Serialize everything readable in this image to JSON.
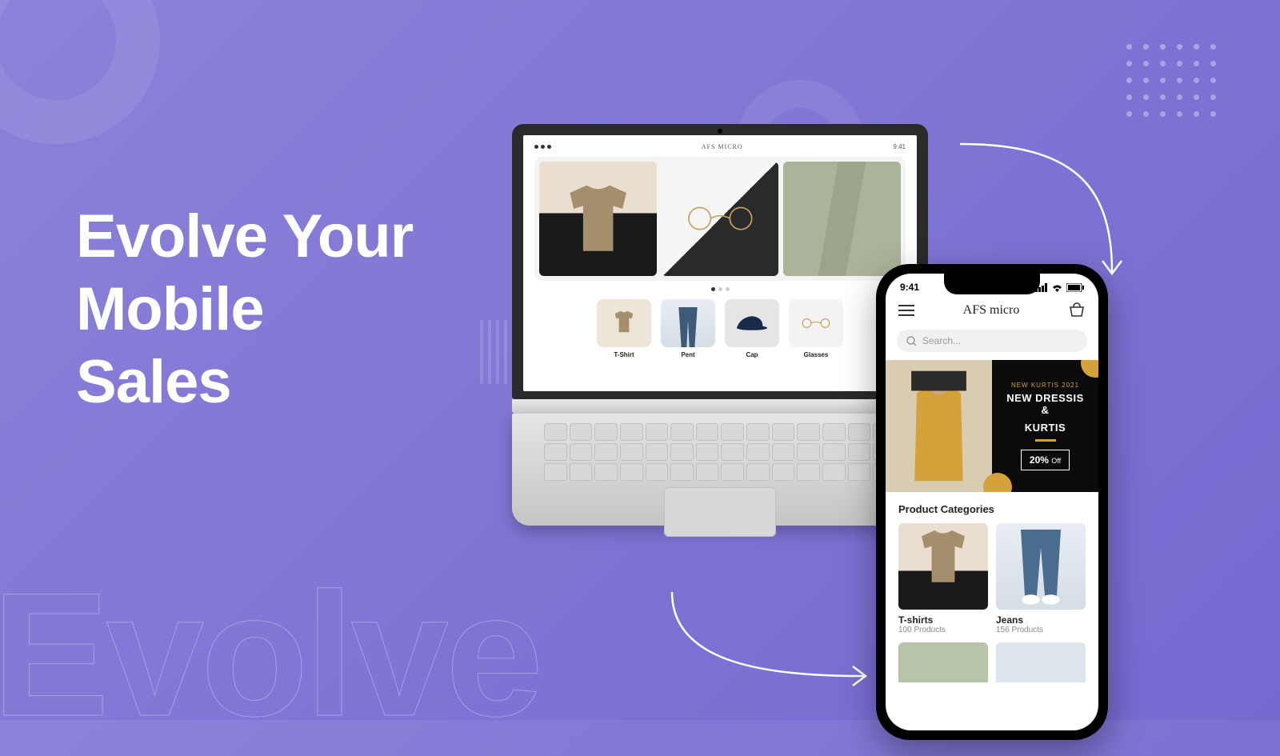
{
  "headline": {
    "line1": "Evolve Your",
    "line2": "Mobile",
    "line3": "Sales"
  },
  "decor": {
    "outline_word": "Evolve"
  },
  "laptop": {
    "brand": "AFS MICRO",
    "clock": "9:41",
    "categories": [
      {
        "label": "T-Shirt"
      },
      {
        "label": "Pent"
      },
      {
        "label": "Cap"
      },
      {
        "label": "Glasses"
      }
    ]
  },
  "phone": {
    "clock": "9:41",
    "brand": "AFS micro",
    "search_placeholder": "Search...",
    "banner": {
      "kicker_prefix": "NEW KURTIS",
      "kicker_year": "2021",
      "title_line1": "NEW DRESSIS &",
      "title_line2": "KURTIS",
      "discount_value": "20%",
      "discount_suffix": "Off"
    },
    "section_title": "Product Categories",
    "categories": [
      {
        "name": "T-shirts",
        "count": "100 Products"
      },
      {
        "name": "Jeans",
        "count": "156 Products"
      }
    ]
  }
}
